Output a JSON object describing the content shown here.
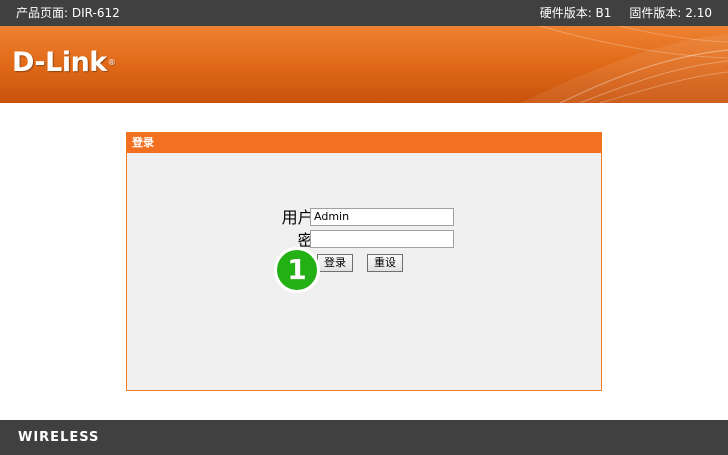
{
  "topbar": {
    "product_page": "产品页面: DIR-612",
    "hardware_version": "硬件版本: B1",
    "firmware_version": "固件版本: 2.10"
  },
  "banner": {
    "logo_text": "D-Link",
    "logo_mark": "®"
  },
  "login": {
    "title": "登录",
    "username_label": "用户名:",
    "username_value": "Admin",
    "password_label": "密码:",
    "password_value": "",
    "login_button": "登录",
    "reset_button": "重设"
  },
  "annotation": {
    "step_number": "1",
    "step_color": "#22b014"
  },
  "footer": {
    "brand_line": "WIRELESS"
  },
  "colors": {
    "accent": "#f37021",
    "bar": "#404040"
  }
}
